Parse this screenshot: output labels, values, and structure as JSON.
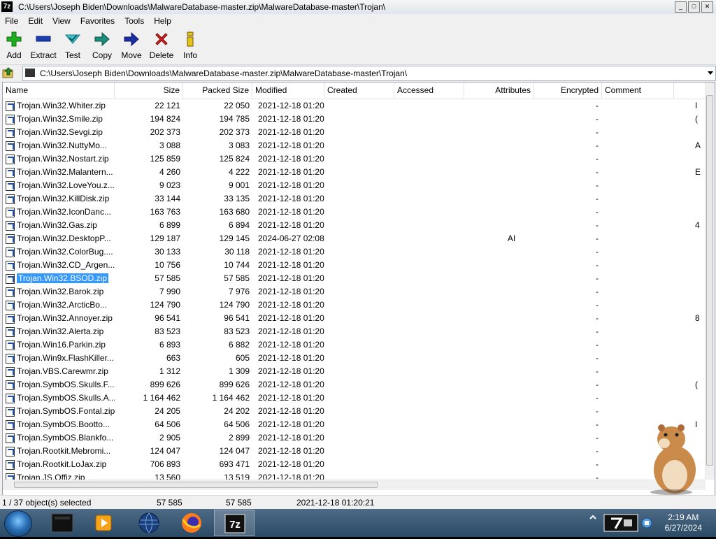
{
  "window": {
    "app_icon_text": "7z",
    "title": "C:\\Users\\Joseph Biden\\Downloads\\MalwareDatabase-master.zip\\MalwareDatabase-master\\Trojan\\"
  },
  "menu": [
    "File",
    "Edit",
    "View",
    "Favorites",
    "Tools",
    "Help"
  ],
  "toolbar": {
    "add": "Add",
    "extract": "Extract",
    "test": "Test",
    "copy": "Copy",
    "move": "Move",
    "delete": "Delete",
    "info": "Info"
  },
  "address": {
    "path": "C:\\Users\\Joseph Biden\\Downloads\\MalwareDatabase-master.zip\\MalwareDatabase-master\\Trojan\\"
  },
  "columns": {
    "name": "Name",
    "size": "Size",
    "packed": "Packed Size",
    "modified": "Modified",
    "created": "Created",
    "accessed": "Accessed",
    "attributes": "Attributes",
    "encrypted": "Encrypted",
    "comment": "Comment"
  },
  "files": [
    {
      "name": "Trojan.Win32.Whiter.zip",
      "size": "22 121",
      "packed": "22 050",
      "modified": "2021-12-18 01:20",
      "attributes": "",
      "encrypted": "-",
      "comment": "I"
    },
    {
      "name": "Trojan.Win32.Smile.zip",
      "size": "194 824",
      "packed": "194 785",
      "modified": "2021-12-18 01:20",
      "attributes": "",
      "encrypted": "-",
      "comment": "("
    },
    {
      "name": "Trojan.Win32.Sevgi.zip",
      "size": "202 373",
      "packed": "202 373",
      "modified": "2021-12-18 01:20",
      "attributes": "",
      "encrypted": "-",
      "comment": ""
    },
    {
      "name": "Trojan.Win32.NuttyMo...",
      "size": "3 088",
      "packed": "3 083",
      "modified": "2021-12-18 01:20",
      "attributes": "",
      "encrypted": "-",
      "comment": "A"
    },
    {
      "name": "Trojan.Win32.Nostart.zip",
      "size": "125 859",
      "packed": "125 824",
      "modified": "2021-12-18 01:20",
      "attributes": "",
      "encrypted": "-",
      "comment": ""
    },
    {
      "name": "Trojan.Win32.Malantern...",
      "size": "4 260",
      "packed": "4 222",
      "modified": "2021-12-18 01:20",
      "attributes": "",
      "encrypted": "-",
      "comment": "E"
    },
    {
      "name": "Trojan.Win32.LoveYou.z...",
      "size": "9 023",
      "packed": "9 001",
      "modified": "2021-12-18 01:20",
      "attributes": "",
      "encrypted": "-",
      "comment": ""
    },
    {
      "name": "Trojan.Win32.KillDisk.zip",
      "size": "33 144",
      "packed": "33 135",
      "modified": "2021-12-18 01:20",
      "attributes": "",
      "encrypted": "-",
      "comment": ""
    },
    {
      "name": "Trojan.Win32.IconDanc...",
      "size": "163 763",
      "packed": "163 680",
      "modified": "2021-12-18 01:20",
      "attributes": "",
      "encrypted": "-",
      "comment": ""
    },
    {
      "name": "Trojan.Win32.Gas.zip",
      "size": "6 899",
      "packed": "6 894",
      "modified": "2021-12-18 01:20",
      "attributes": "",
      "encrypted": "-",
      "comment": "4"
    },
    {
      "name": "Trojan.Win32.DesktopP...",
      "size": "129 187",
      "packed": "129 145",
      "modified": "2024-06-27 02:08",
      "attributes": "AI",
      "encrypted": "-",
      "comment": ""
    },
    {
      "name": "Trojan.Win32.ColorBug....",
      "size": "30 133",
      "packed": "30 118",
      "modified": "2021-12-18 01:20",
      "attributes": "",
      "encrypted": "-",
      "comment": ""
    },
    {
      "name": "Trojan.Win32.CD_Argen...",
      "size": "10 756",
      "packed": "10 744",
      "modified": "2021-12-18 01:20",
      "attributes": "",
      "encrypted": "-",
      "comment": ""
    },
    {
      "name": "Trojan.Win32.BSOD.zip",
      "size": "57 585",
      "packed": "57 585",
      "modified": "2021-12-18 01:20",
      "attributes": "",
      "encrypted": "-",
      "comment": "",
      "selected": true
    },
    {
      "name": "Trojan.Win32.Barok.zip",
      "size": "7 990",
      "packed": "7 976",
      "modified": "2021-12-18 01:20",
      "attributes": "",
      "encrypted": "-",
      "comment": ""
    },
    {
      "name": "Trojan.Win32.ArcticBo...",
      "size": "124 790",
      "packed": "124 790",
      "modified": "2021-12-18 01:20",
      "attributes": "",
      "encrypted": "-",
      "comment": ""
    },
    {
      "name": "Trojan.Win32.Annoyer.zip",
      "size": "96 541",
      "packed": "96 541",
      "modified": "2021-12-18 01:20",
      "attributes": "",
      "encrypted": "-",
      "comment": "8"
    },
    {
      "name": "Trojan.Win32.Alerta.zip",
      "size": "83 523",
      "packed": "83 523",
      "modified": "2021-12-18 01:20",
      "attributes": "",
      "encrypted": "-",
      "comment": ""
    },
    {
      "name": "Trojan.Win16.Parkin.zip",
      "size": "6 893",
      "packed": "6 882",
      "modified": "2021-12-18 01:20",
      "attributes": "",
      "encrypted": "-",
      "comment": ""
    },
    {
      "name": "Trojan.Win9x.FlashKiller...",
      "size": "663",
      "packed": "605",
      "modified": "2021-12-18 01:20",
      "attributes": "",
      "encrypted": "-",
      "comment": ""
    },
    {
      "name": "Trojan.VBS.Carewmr.zip",
      "size": "1 312",
      "packed": "1 309",
      "modified": "2021-12-18 01:20",
      "attributes": "",
      "encrypted": "-",
      "comment": ""
    },
    {
      "name": "Trojan.SymbOS.Skulls.F....",
      "size": "899 626",
      "packed": "899 626",
      "modified": "2021-12-18 01:20",
      "attributes": "",
      "encrypted": "-",
      "comment": "("
    },
    {
      "name": "Trojan.SymbOS.Skulls.A...",
      "size": "1 164 462",
      "packed": "1 164 462",
      "modified": "2021-12-18 01:20",
      "attributes": "",
      "encrypted": "-",
      "comment": ""
    },
    {
      "name": "Trojan.SymbOS.Fontal.zip",
      "size": "24 205",
      "packed": "24 202",
      "modified": "2021-12-18 01:20",
      "attributes": "",
      "encrypted": "-",
      "comment": ""
    },
    {
      "name": "Trojan.SymbOS.Bootto...",
      "size": "64 506",
      "packed": "64 506",
      "modified": "2021-12-18 01:20",
      "attributes": "",
      "encrypted": "-",
      "comment": "I"
    },
    {
      "name": "Trojan.SymbOS.Blankfo...",
      "size": "2 905",
      "packed": "2 899",
      "modified": "2021-12-18 01:20",
      "attributes": "",
      "encrypted": "-",
      "comment": ""
    },
    {
      "name": "Trojan.Rootkit.Mebromi...",
      "size": "124 047",
      "packed": "124 047",
      "modified": "2021-12-18 01:20",
      "attributes": "",
      "encrypted": "-",
      "comment": ""
    },
    {
      "name": "Trojan.Rootkit.LoJax.zip",
      "size": "706 893",
      "packed": "693 471",
      "modified": "2021-12-18 01:20",
      "attributes": "",
      "encrypted": "-",
      "comment": ""
    },
    {
      "name": "Trojan.JS.Offiz.zip",
      "size": "13 560",
      "packed": "13 519",
      "modified": "2021-12-18 01:20",
      "attributes": "",
      "encrypted": "-",
      "comment": ""
    }
  ],
  "status": {
    "selection": "1 / 37 object(s) selected",
    "size": "57 585",
    "packed": "57 585",
    "modified": "2021-12-18 01:20:21"
  },
  "taskbar": {
    "active_app_label": "7z",
    "time": "2:19 AM",
    "date": "6/27/2024"
  },
  "colors": {
    "selection": "#3399ff",
    "taskbar": "#3b5b7a"
  }
}
